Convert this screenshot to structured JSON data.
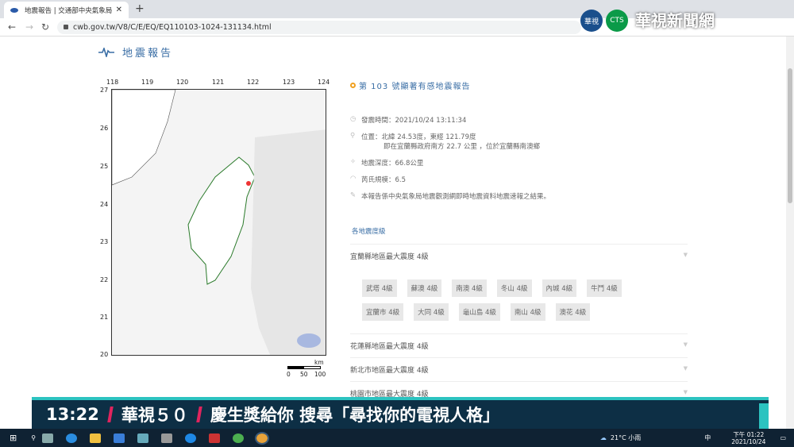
{
  "browser": {
    "tab_title": "地震報告 | 交通部中央氣象局",
    "url": "cwb.gov.tw/V8/C/E/EQ/EQ110103-1024-131134.html"
  },
  "overlay": {
    "channel_name": "華視新聞網",
    "logo_text": "華視",
    "cts_text": "CTS"
  },
  "page": {
    "header": "地震報告"
  },
  "map": {
    "lon_ticks": [
      "118",
      "119",
      "120",
      "121",
      "122",
      "123",
      "124"
    ],
    "lat_ticks": [
      "27",
      "26",
      "25",
      "24",
      "23",
      "22",
      "21",
      "20"
    ],
    "scale_unit": "km",
    "scale_labels": [
      "0",
      "50",
      "100"
    ]
  },
  "report": {
    "title": "第 103 號顯著有感地震報告",
    "time": "發震時間：2021/10/24 13:11:34",
    "location": "位置：北緯 24.53度，東經 121.79度",
    "location_detail": "即在宜蘭縣政府南方 22.7 公里 ，位於宜蘭縣南澳鄉",
    "depth": "地震深度：66.8公里",
    "magnitude": "芮氏規模：6.5",
    "note": "本報告係中央氣象局地震觀測網即時地震資料地震速報之結果。"
  },
  "intensity": {
    "section_title": "各地震度級",
    "regions": [
      "宜蘭縣地區最大震度 4級",
      "花蓮縣地區最大震度 4級",
      "新北市地區最大震度 4級",
      "桃園市地區最大震度 4級"
    ],
    "yilan_stations": [
      "武塔 4級",
      "蘇澳 4級",
      "南澳 4級",
      "冬山 4級",
      "內城 4級",
      "牛鬥 4級",
      "宜蘭市 4級",
      "大同 4級",
      "龜山島 4級",
      "南山 4級",
      "澳花 4級"
    ]
  },
  "banner": {
    "time": "13:22",
    "text1": "華視５０",
    "text2": "慶生獎給你 搜尋「尋找你的電視人格」"
  },
  "taskbar": {
    "weather": "21°C 小雨",
    "ime": "中",
    "clock_time": "下午 01:22",
    "clock_date": "2021/10/24"
  }
}
